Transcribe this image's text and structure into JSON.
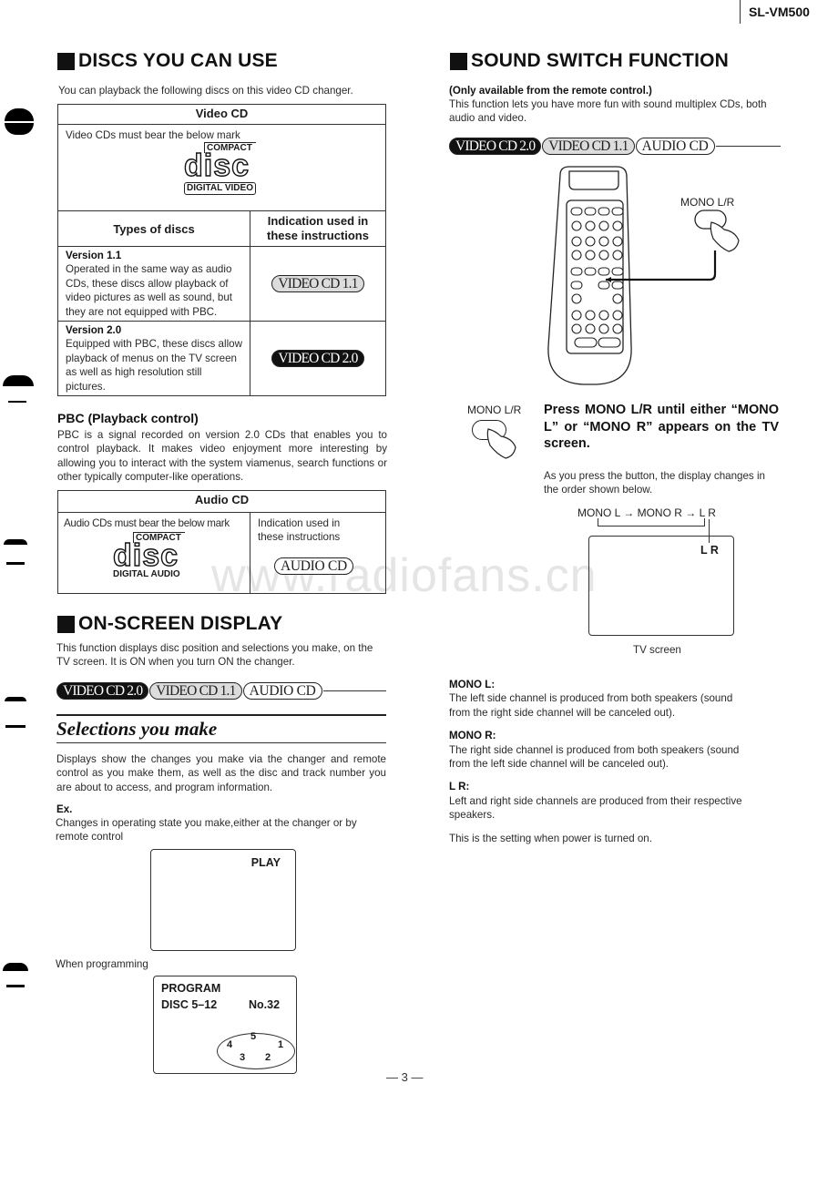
{
  "header": {
    "model": "SL-VM500"
  },
  "badges": {
    "v20": "VIDEO CD 2.0",
    "v11": "VIDEO CD 1.1",
    "audio": "AUDIO CD"
  },
  "discs": {
    "title": "DISCS YOU CAN USE",
    "intro": "You can playback the following discs on this video CD changer.",
    "video_table": {
      "header": "Video CD",
      "mark_text": "Video CDs must bear the below mark",
      "logo": {
        "top": "COMPACT",
        "main": "disc",
        "bottom": "DIGITAL VIDEO"
      },
      "col_types": "Types of discs",
      "col_indication": "Indication used in these instructions",
      "rows": [
        {
          "title": "Version 1.1",
          "desc": "Operated in the same way as audio CDs, these discs allow playback of video pictures as well as sound, but they are not equipped with PBC.",
          "badge": "VIDEO CD 1.1"
        },
        {
          "title": "Version 2.0",
          "desc": "Equipped with PBC, these discs allow playback of menus on the TV screen as well as high resolution still pictures.",
          "badge": "VIDEO CD 2.0"
        }
      ]
    },
    "pbc": {
      "title": "PBC (Playback control)",
      "text": "PBC is a signal recorded on version 2.0 CDs that enables you to control playback. It makes video enjoyment more interesting by allowing you to interact with the system viamenus, search functions or other typically computer-like operations."
    },
    "audio_table": {
      "header": "Audio CD",
      "mark_text": "Audio CDs must bear the below mark",
      "logo": {
        "top": "COMPACT",
        "main": "disc",
        "bottom": "DIGITAL AUDIO"
      },
      "indication": "Indication used in these instructions",
      "badge": "AUDIO CD"
    }
  },
  "osd": {
    "title": "ON-SCREEN DISPLAY",
    "intro": "This function displays disc position and selections you make, on the TV screen. It is ON when you turn ON the changer.",
    "subtitle": "Selections you make",
    "desc": "Displays show the changes you make via the changer and remote control as you make them, as well as the disc and track number you are about to access, and program information.",
    "ex_label": "Ex.",
    "ex_text": "Changes in operating state you make,either at the changer or by remote control",
    "screen1": {
      "text": "PLAY"
    },
    "programming_label": "When programming",
    "screen2": {
      "line1": "PROGRAM",
      "disc": "DISC 5–12",
      "no": "No.32",
      "carousel": [
        "5",
        "4",
        "1",
        "3",
        "2"
      ]
    }
  },
  "sound": {
    "title": "SOUND SWITCH FUNCTION",
    "note": "(Only available from the remote control.)",
    "intro": "This function lets you have more fun with sound multiplex CDs, both audio and video.",
    "button_label": "MONO L/R",
    "instruction": "Press MONO L/R until either “MONO L” or “MONO R” appears on the TV screen.",
    "order_text": "As you press the button, the display changes in the order shown below.",
    "sequence": [
      "MONO L",
      "MONO R",
      "L R"
    ],
    "tv_display": "L R",
    "tv_caption": "TV screen",
    "modes": [
      {
        "label": "MONO L:",
        "desc": "The left side channel is produced from both speakers (sound from the right side channel will be canceled out)."
      },
      {
        "label": "MONO R:",
        "desc": "The right side channel is produced from both speakers (sound from the left side channel will be canceled out)."
      },
      {
        "label": "L R:",
        "desc": "Left and right side channels are produced from their respective speakers."
      }
    ],
    "power_note": "This is the setting when power is turned on."
  },
  "footer": {
    "page": "— 3 —"
  },
  "watermark": "www.radiofans.cn"
}
